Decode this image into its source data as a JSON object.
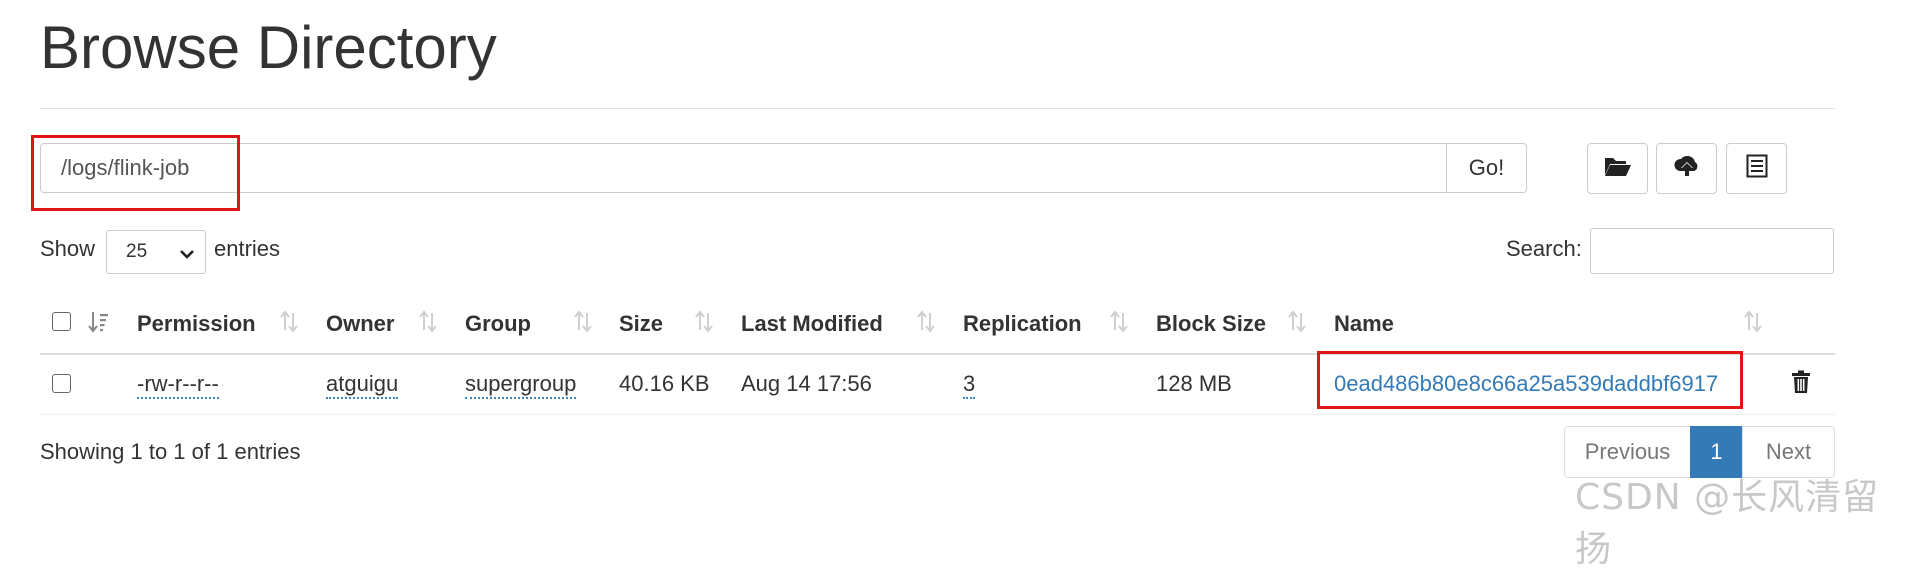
{
  "page": {
    "title": "Browse Directory",
    "path_value": "/logs/flink-job",
    "go_label": "Go!"
  },
  "toolbar": {
    "icons": [
      "folder-open-icon",
      "upload-icon",
      "list-icon"
    ]
  },
  "controls": {
    "show_label": "Show",
    "entries_value": "25",
    "entries_label": "entries",
    "search_label": "Search:"
  },
  "table": {
    "columns": [
      "Permission",
      "Owner",
      "Group",
      "Size",
      "Last Modified",
      "Replication",
      "Block Size",
      "Name"
    ],
    "rows": [
      {
        "permission": "-rw-r--r--",
        "owner": "atguigu",
        "group": "supergroup",
        "size": "40.16 KB",
        "last_modified": "Aug 14 17:56",
        "replication": "3",
        "block_size": "128 MB",
        "name": "0ead486b80e8c66a25a539daddbf6917"
      }
    ]
  },
  "footer": {
    "info": "Showing 1 to 1 of 1 entries",
    "previous": "Previous",
    "current_page": "1",
    "next": "Next"
  },
  "watermark": "CSDN @长风清留扬",
  "colors": {
    "link": "#337ab7",
    "highlight_box": "#e01515",
    "active_page": "#337ab7"
  }
}
